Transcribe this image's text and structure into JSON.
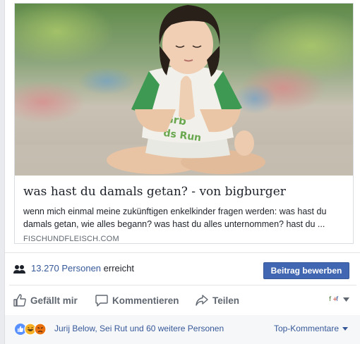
{
  "link_preview": {
    "title": "was hast du damals getan? - von bigburger",
    "description": "wenn mich einmal meine zukünftigen enkelkinder fragen werden: was hast du damals getan, wie alles begann? was hast du alles unternommen? hast du ...",
    "domain": "FISCHUNDFLEISCH.COM",
    "image_alt": "Child meditating in lotus pose"
  },
  "reach": {
    "count": "13.270 Personen",
    "suffix": " erreicht",
    "promote_label": "Beitrag bewerben"
  },
  "actions": {
    "like": "Gefällt mir",
    "comment": "Kommentieren",
    "share": "Teilen"
  },
  "reactions": {
    "names": "Jurij Below, Sei Rut und 60 weitere Personen",
    "sort_label": "Top-Kommentare"
  },
  "colors": {
    "accent": "#4267b2",
    "link": "#365899"
  }
}
